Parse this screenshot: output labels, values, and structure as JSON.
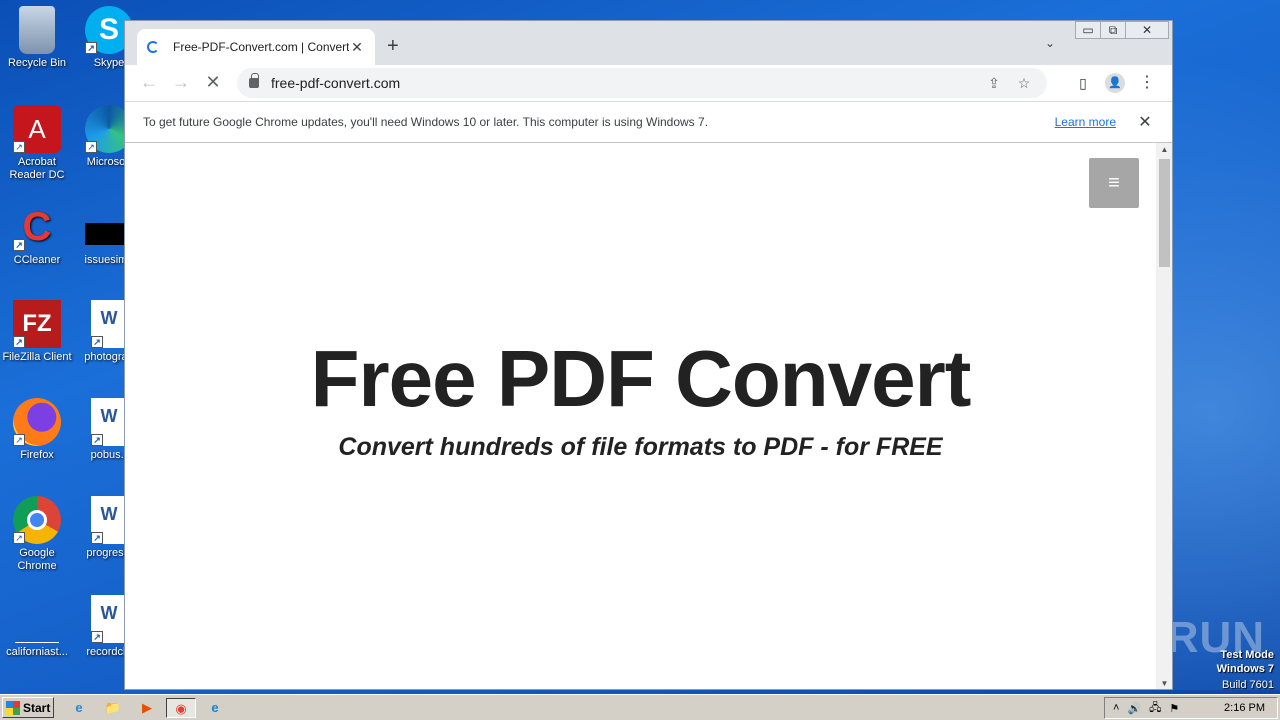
{
  "desktop": {
    "icons": [
      {
        "label": "Recycle Bin",
        "glyph": "🗑"
      },
      {
        "label": "Skype",
        "glyph": "S"
      },
      {
        "label": "Acrobat Reader DC",
        "glyph": "A"
      },
      {
        "label": "Microsoft",
        "glyph": "e"
      },
      {
        "label": "CCleaner",
        "glyph": "C"
      },
      {
        "label": "issuesimp",
        "glyph": ""
      },
      {
        "label": "FileZilla Client",
        "glyph": "FZ"
      },
      {
        "label": "photograp",
        "glyph": "W"
      },
      {
        "label": "Firefox",
        "glyph": "🦊"
      },
      {
        "label": "pobus.r",
        "glyph": "W"
      },
      {
        "label": "Google Chrome",
        "glyph": "◉"
      },
      {
        "label": "progressi",
        "glyph": "W"
      },
      {
        "label": "californiast...",
        "glyph": ""
      },
      {
        "label": "recordclo",
        "glyph": "W"
      }
    ],
    "watermark": "ANY▷RUN",
    "os_notice": {
      "line1": "Test Mode",
      "line2": "Windows 7",
      "line3": "Build 7601"
    }
  },
  "browser": {
    "tab": {
      "title": "Free-PDF-Convert.com | Convert hu",
      "close": "✕"
    },
    "new_tab": "+",
    "tab_menu": "⌄",
    "window_controls": {
      "minimize": "▭",
      "restore": "⧉",
      "close": "✕"
    },
    "nav": {
      "back": "←",
      "forward": "→",
      "stop": "✕"
    },
    "omnibox": {
      "url": "free-pdf-convert.com",
      "share_icon": "⇪",
      "star_icon": "☆"
    },
    "toolbar_icons": {
      "side_panel": "▯",
      "profile": "👤",
      "menu": "⋮"
    },
    "infobar": {
      "message": "To get future Google Chrome updates, you'll need Windows 10 or later. This computer is using Windows 7.",
      "link": "Learn more",
      "close": "✕"
    }
  },
  "page": {
    "menu_icon": "≡",
    "title": "Free PDF Convert",
    "subtitle": "Convert hundreds of file formats to PDF - for FREE"
  },
  "taskbar": {
    "start": "Start",
    "apps": [
      {
        "name": "ie-icon",
        "glyph": "e"
      },
      {
        "name": "explorer-icon",
        "glyph": "📁"
      },
      {
        "name": "media-player-icon",
        "glyph": "▶"
      },
      {
        "name": "chrome-icon",
        "glyph": "◉"
      },
      {
        "name": "edge-icon",
        "glyph": "e"
      }
    ],
    "tray": {
      "expand": "˄",
      "volume": "🔊",
      "network": "🖧",
      "flag": "⚑",
      "clock": "2:16 PM"
    }
  },
  "colors": {
    "desktop": "#1560c9",
    "accent": "#1a73e8",
    "menu_button": "#a6a6a6"
  }
}
